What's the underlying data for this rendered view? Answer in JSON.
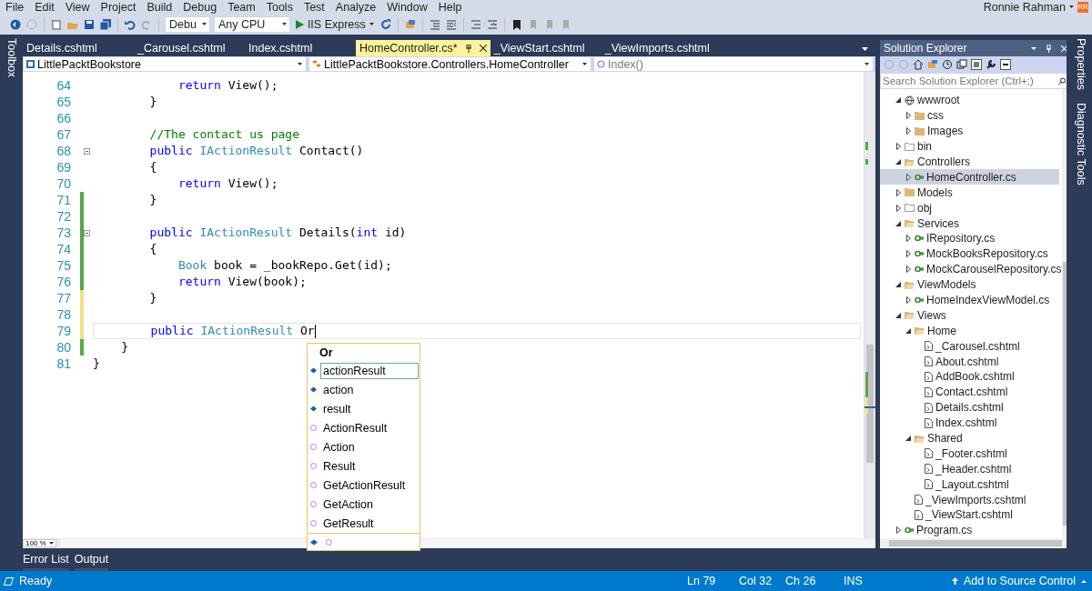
{
  "menu": [
    "File",
    "Edit",
    "View",
    "Project",
    "Build",
    "Debug",
    "Team",
    "Tools",
    "Test",
    "Analyze",
    "Window",
    "Help"
  ],
  "account": {
    "name": "Ronnie Rahman",
    "initials": "RR"
  },
  "toolbar": {
    "configuration": "Debu",
    "platform": "Any CPU",
    "run": "IIS Express"
  },
  "left_strip": [
    "Toolbox"
  ],
  "editor": {
    "tabs": [
      {
        "label": "Details.cshtml",
        "selected": false
      },
      {
        "label": "_Carousel.cshtml",
        "selected": false
      },
      {
        "label": "Index.cshtml",
        "selected": false
      },
      {
        "label": "HomeController.cs*",
        "selected": true
      },
      {
        "label": "_ViewStart.cshtml",
        "selected": false
      },
      {
        "label": "_ViewImports.cshtml",
        "selected": false
      }
    ],
    "nav": {
      "project": "LittlePacktBookstore",
      "type": "LittlePacktBookstore.Controllers.HomeController",
      "member": "Index()"
    },
    "lines": [
      {
        "number": "64",
        "fold": false,
        "current": false,
        "tokens": [
          {
            "text": "            return",
            "kind": "keyword"
          },
          {
            "text": " View();",
            "kind": "plain"
          }
        ]
      },
      {
        "number": "65",
        "fold": false,
        "current": false,
        "tokens": [
          {
            "text": "        }",
            "kind": "plain"
          }
        ]
      },
      {
        "number": "66",
        "fold": false,
        "current": false
      },
      {
        "number": "67",
        "fold": false,
        "current": false,
        "tokens": [
          {
            "text": "        //The contact us page",
            "kind": "comment"
          }
        ]
      },
      {
        "number": "68",
        "fold": true,
        "current": false,
        "tokens": [
          {
            "text": "        public",
            "kind": "keyword"
          },
          {
            "text": " IActionResult",
            "kind": "type"
          },
          {
            "text": " Contact()",
            "kind": "plain"
          }
        ]
      },
      {
        "number": "69",
        "fold": false,
        "current": false,
        "tokens": [
          {
            "text": "        {",
            "kind": "plain"
          }
        ]
      },
      {
        "number": "70",
        "fold": false,
        "current": false,
        "tokens": [
          {
            "text": "            return",
            "kind": "keyword"
          },
          {
            "text": " View();",
            "kind": "plain"
          }
        ]
      },
      {
        "number": "71",
        "color": "#57a64a",
        "fold": false,
        "current": false,
        "tokens": [
          {
            "text": "        }",
            "kind": "plain"
          }
        ]
      },
      {
        "number": "72",
        "color": "#57a64a",
        "fold": false,
        "current": false
      },
      {
        "number": "73",
        "color": "#57a64a",
        "fold": true,
        "current": false,
        "tokens": [
          {
            "text": "        public",
            "kind": "keyword"
          },
          {
            "text": " IActionResult",
            "kind": "type"
          },
          {
            "text": " Details(",
            "kind": "plain"
          },
          {
            "text": "int",
            "kind": "keyword"
          },
          {
            "text": " id)",
            "kind": "plain"
          }
        ]
      },
      {
        "number": "74",
        "color": "#57a64a",
        "fold": false,
        "current": false,
        "tokens": [
          {
            "text": "        {",
            "kind": "plain"
          }
        ]
      },
      {
        "number": "75",
        "color": "#57a64a",
        "fold": false,
        "current": false,
        "tokens": [
          {
            "text": "            Book",
            "kind": "type"
          },
          {
            "text": " book = _bookRepo.Get(id);",
            "kind": "plain"
          }
        ]
      },
      {
        "number": "76",
        "color": "#57a64a",
        "fold": false,
        "current": false,
        "tokens": [
          {
            "text": "            return",
            "kind": "keyword"
          },
          {
            "text": " View(book);",
            "kind": "plain"
          }
        ]
      },
      {
        "number": "77",
        "color": "#efe27e",
        "fold": false,
        "current": false,
        "tokens": [
          {
            "text": "        }",
            "kind": "plain"
          }
        ]
      },
      {
        "number": "78",
        "color": "#efe27e",
        "fold": false,
        "current": false
      },
      {
        "number": "79",
        "color": "#efe27e",
        "fold": false,
        "current": true,
        "tokens": [
          {
            "text": "        public",
            "kind": "keyword"
          },
          {
            "text": " IActionResult",
            "kind": "type"
          },
          {
            "text": " Or",
            "kind": "plain"
          }
        ]
      },
      {
        "number": "80",
        "color": "#57a64a",
        "fold": false,
        "current": false,
        "tokens": [
          {
            "text": "    }",
            "kind": "plain"
          }
        ]
      },
      {
        "number": "81",
        "fold": false,
        "current": false,
        "tokens": [
          {
            "text": "}",
            "kind": "plain"
          }
        ]
      }
    ],
    "completion": {
      "header": "Or",
      "items": [
        {
          "label": "actionResult",
          "kind": "local",
          "selected": true
        },
        {
          "label": "action",
          "kind": "local",
          "selected": false
        },
        {
          "label": "result",
          "kind": "local",
          "selected": false
        },
        {
          "label": "ActionResult",
          "kind": "suggestion",
          "selected": false
        },
        {
          "label": "Action",
          "kind": "suggestion",
          "selected": false
        },
        {
          "label": "Result",
          "kind": "suggestion",
          "selected": false
        },
        {
          "label": "GetActionResult",
          "kind": "suggestion",
          "selected": false
        },
        {
          "label": "GetAction",
          "kind": "suggestion",
          "selected": false
        },
        {
          "label": "GetResult",
          "kind": "suggestion",
          "selected": false
        }
      ]
    },
    "zoom": "100 %"
  },
  "solution_explorer": {
    "title": "Solution Explorer",
    "search": {
      "placeholder": "Search Solution Explorer (Ctrl+;)"
    },
    "tree": [
      {
        "label": "wwwroot",
        "kind": "web",
        "expanded": true,
        "selected": false,
        "children": [
          {
            "label": "css",
            "kind": "folder",
            "expanded": false,
            "selected": false
          },
          {
            "label": "Images",
            "kind": "folder",
            "expanded": false,
            "selected": false
          }
        ]
      },
      {
        "label": "bin",
        "kind": "hidden-folder",
        "expanded": false,
        "selected": false
      },
      {
        "label": "Controllers",
        "kind": "folder",
        "expanded": true,
        "selected": false,
        "children": [
          {
            "label": "HomeController.cs",
            "kind": "csharp",
            "expanded": false,
            "selected": true
          }
        ]
      },
      {
        "label": "Models",
        "kind": "folder",
        "expanded": false,
        "selected": false
      },
      {
        "label": "obj",
        "kind": "hidden-folder",
        "expanded": false,
        "selected": false
      },
      {
        "label": "Services",
        "kind": "folder",
        "expanded": true,
        "selected": false,
        "children": [
          {
            "label": "IRepository.cs",
            "kind": "csharp",
            "expanded": false,
            "selected": false
          },
          {
            "label": "MockBooksRepository.cs",
            "kind": "csharp",
            "expanded": false,
            "selected": false
          },
          {
            "label": "MockCarouselRepository.cs",
            "kind": "csharp",
            "expanded": false,
            "selected": false
          }
        ]
      },
      {
        "label": "ViewModels",
        "kind": "folder",
        "expanded": true,
        "selected": false,
        "children": [
          {
            "label": "HomeIndexViewModel.cs",
            "kind": "csharp",
            "expanded": false,
            "selected": false
          }
        ]
      },
      {
        "label": "Views",
        "kind": "folder",
        "expanded": true,
        "selected": false,
        "children": [
          {
            "label": "Home",
            "kind": "folder",
            "expanded": true,
            "selected": false,
            "children": [
              {
                "label": "_Carousel.cshtml",
                "kind": "razor",
                "selected": false
              },
              {
                "label": "About.cshtml",
                "kind": "razor",
                "selected": false
              },
              {
                "label": "AddBook.cshtml",
                "kind": "razor",
                "selected": false
              },
              {
                "label": "Contact.cshtml",
                "kind": "razor",
                "selected": false
              },
              {
                "label": "Details.cshtml",
                "kind": "razor",
                "selected": false
              },
              {
                "label": "Index.cshtml",
                "kind": "razor",
                "selected": false
              }
            ]
          },
          {
            "label": "Shared",
            "kind": "folder",
            "expanded": true,
            "selected": false,
            "children": [
              {
                "label": "_Footer.cshtml",
                "kind": "razor",
                "selected": false
              },
              {
                "label": "_Header.cshtml",
                "kind": "razor",
                "selected": false
              },
              {
                "label": "_Layout.cshtml",
                "kind": "razor",
                "selected": false
              }
            ]
          },
          {
            "label": "_ViewImports.cshtml",
            "kind": "razor",
            "selected": false
          },
          {
            "label": "_ViewStart.cshtml",
            "kind": "razor",
            "selected": false
          }
        ]
      },
      {
        "label": "Program.cs",
        "kind": "csharp",
        "expanded": false,
        "selected": false
      }
    ]
  },
  "right_strip": [
    "Properties",
    "Diagnostic Tools"
  ],
  "bottom_tabs": [
    "Error List",
    "Output"
  ],
  "status_bar": {
    "message": "Ready",
    "line": "Ln 79",
    "column": "Col 32",
    "char": "Ch 26",
    "mode": "INS",
    "source_control": "Add to Source Control"
  }
}
